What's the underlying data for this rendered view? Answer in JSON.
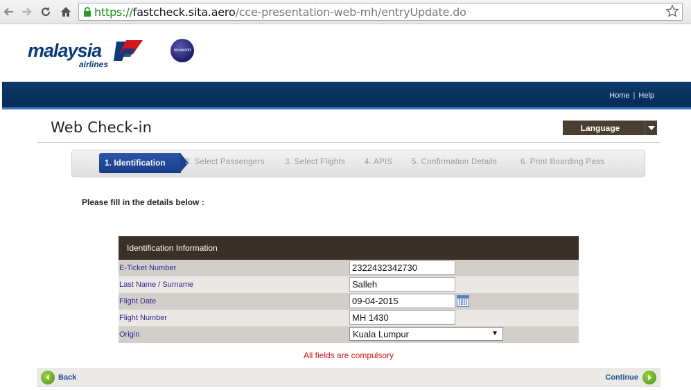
{
  "browser": {
    "url_scheme": "https://",
    "url_host": "fastcheck.sita.aero",
    "url_path": "/cce-presentation-web-mh/entryUpdate.do"
  },
  "header": {
    "logo_text": "malaysia",
    "logo_sub": "airlines",
    "alliance_badge": "oneworld"
  },
  "band": {
    "home_label": "Home",
    "separator": "|",
    "help_label": "Help"
  },
  "page": {
    "title": "Web Check-in",
    "language_label": "Language",
    "instruction": "Please fill in the details below :"
  },
  "steps": [
    {
      "label": "1. Identification",
      "active": true
    },
    {
      "label": "2. Select Passengers",
      "active": false
    },
    {
      "label": "3. Select Flights",
      "active": false
    },
    {
      "label": "4. APIS",
      "active": false
    },
    {
      "label": "5. Confirmation Details",
      "active": false
    },
    {
      "label": "6. Print Boarding Pass",
      "active": false
    }
  ],
  "form": {
    "heading": "Identification Information",
    "fields": [
      {
        "label": "E-Ticket Number",
        "value": "2322432342730"
      },
      {
        "label": "Last Name / Surname",
        "value": "Salleh"
      },
      {
        "label": "Flight Date",
        "value": "09-04-2015"
      },
      {
        "label": "Flight Number",
        "value": "MH 1430"
      },
      {
        "label": "Origin",
        "value": "Kuala Lumpur"
      }
    ],
    "compulsory_note": "All fields are compulsory"
  },
  "footer": {
    "back_label": "Back",
    "continue_label": "Continue"
  },
  "colors": {
    "brand_blue": "#0b3a6b",
    "step_active": "#213f90",
    "form_header": "#3a3028",
    "error_red": "#cc1111",
    "nav_green": "#6bb526"
  }
}
